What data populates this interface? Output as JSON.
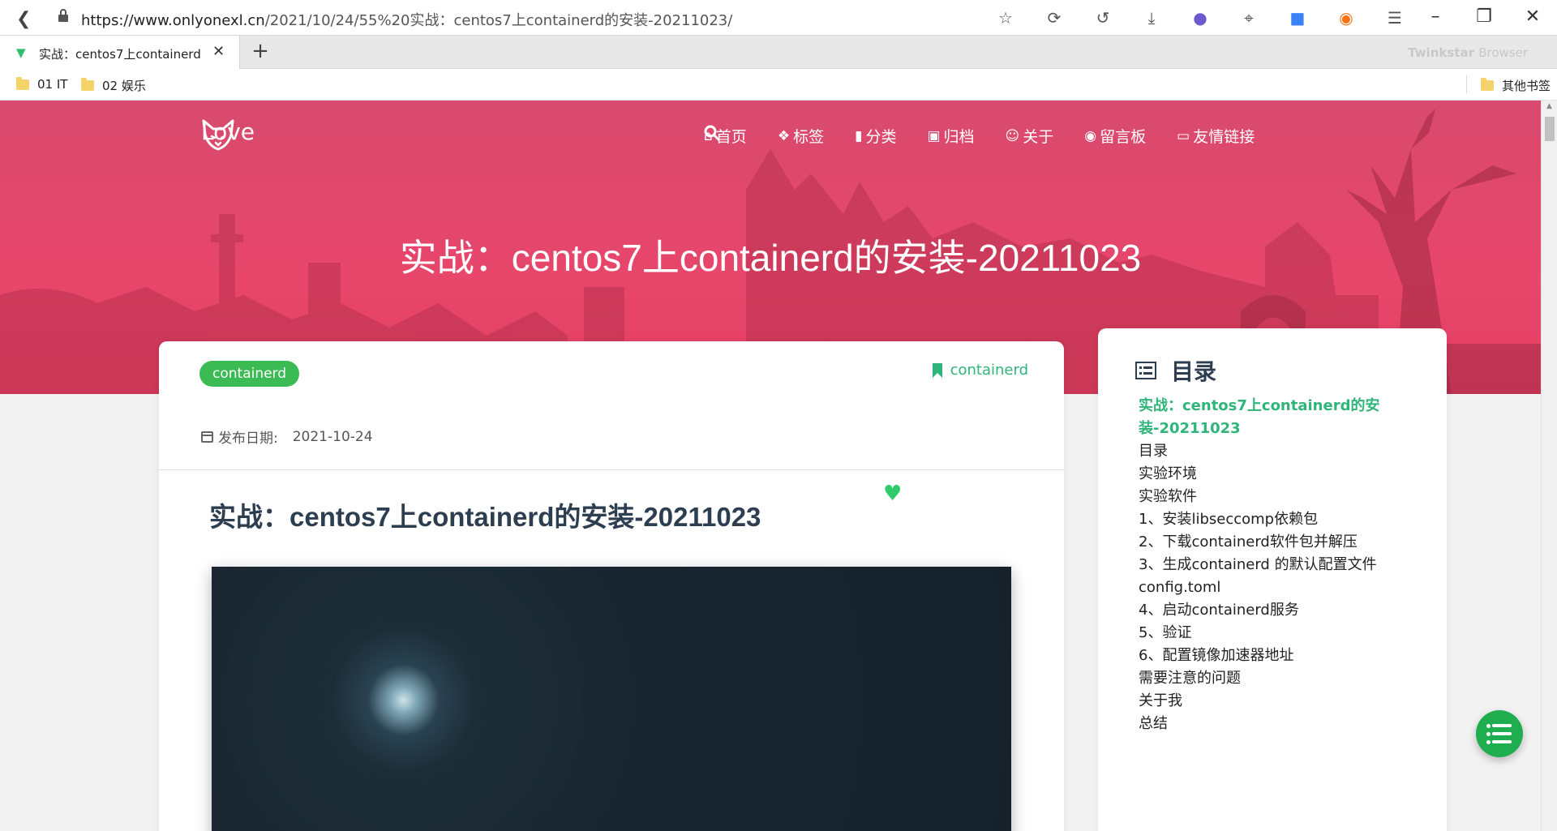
{
  "browser": {
    "url_host": "https://www.onlyonexl.cn",
    "url_path": "/2021/10/24/55%20实战：centos7上containerd的安装-20211023/",
    "tab_title": "实战：centos7上containerd的",
    "brand": "Twinkstar",
    "brand_suffix": "Browser",
    "bookmarks": [
      "01 IT",
      "02 娱乐"
    ],
    "other_bookmarks": "其他书签"
  },
  "site": {
    "logo_text": "Love",
    "nav": [
      {
        "icon": "home-icon",
        "label": "首页"
      },
      {
        "icon": "tags-icon",
        "label": "标签"
      },
      {
        "icon": "bookmark-icon",
        "label": "分类"
      },
      {
        "icon": "archive-icon",
        "label": "归档"
      },
      {
        "icon": "user-circle-icon",
        "label": "关于"
      },
      {
        "icon": "comments-icon",
        "label": "留言板"
      },
      {
        "icon": "address-book-icon",
        "label": "友情链接"
      }
    ],
    "hero_title": "实战：centos7上containerd的安装-20211023"
  },
  "article": {
    "tag": "containerd",
    "category": "containerd",
    "date_label": "发布日期:",
    "date": "2021-10-24",
    "title": "实战：centos7上containerd的安装-20211023"
  },
  "toc": {
    "heading": "目录",
    "items": [
      "实战：centos7上containerd的安装-20211023",
      "目录",
      "实验环境",
      "实验软件",
      "1、安装libseccomp依赖包",
      "2、下载containerd软件包并解压",
      "3、生成containerd 的默认配置文件config.toml",
      "4、启动containerd服务",
      "5、验证",
      "6、配置镜像加速器地址",
      "需要注意的问题",
      "关于我",
      "总结"
    ]
  },
  "colors": {
    "hero": "#e8466b",
    "accent_green": "#2fb57a",
    "tag_green": "#3cba54",
    "title_dark": "#2c3e50"
  }
}
